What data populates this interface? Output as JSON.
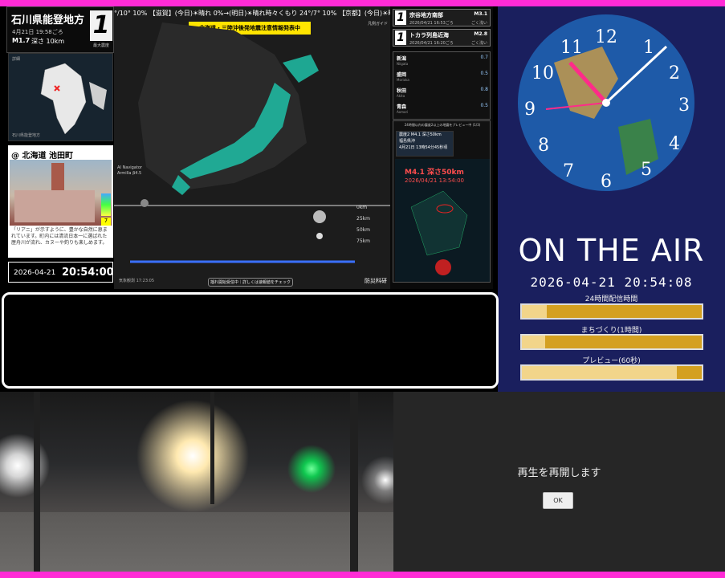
{
  "quake": {
    "region": "石川県能登地方",
    "time": "4月21日 19:58ごろ",
    "magnitude": "M1.7",
    "depth": "深さ 10km",
    "intensity": "1",
    "intensity_label": "最大震度"
  },
  "minimap": {
    "tag": "詳細",
    "caption": "石川県能登地方"
  },
  "camera_card": {
    "title": "@ 北海道 池田町",
    "scale_value": "7",
    "text": "「リアニ」が示すように、豊かな自然に恵まれています。町内には清流日本一に選ばれた歴舟川が流れ、カヌーや釣りも楽しめます。"
  },
  "local_clock": {
    "date": "2026-04-21",
    "time": "20:54:00"
  },
  "map": {
    "ticker": "°/10° 10% 【滋賀】(今日)☀晴れ 0%→(明日)☀晴れ時々くもり 24°/7° 10% 【京都】(今日)☀晴れ 0%→(",
    "alert": "北海道・三陸沖後発地震注意情報発表中",
    "ai_label_1": "AI Navigator",
    "ai_label_2": "Armilla β4.5",
    "guide_label": "凡例ガイド",
    "distances": [
      "0km",
      "25km",
      "50km",
      "75km"
    ],
    "footer": "気象観測 17:23:05",
    "button_label": "揺れ開始受信中｜詳しくは速報値をチェック",
    "brand": "防災科研"
  },
  "recent_quakes": [
    {
      "num": "1",
      "region": "宗谷地方南部",
      "time": "2026/04/21 16:53ごろ",
      "magnitude": "M3.1",
      "depth": "ごく浅い"
    },
    {
      "num": "1",
      "region": "トカラ列島近海",
      "time": "2026/04/21 16:20ごろ",
      "magnitude": "M2.8",
      "depth": "ごく浅い"
    }
  ],
  "sensors": [
    {
      "name": "新潟",
      "roman": "Niigata",
      "value": "0.7"
    },
    {
      "name": "盛岡",
      "roman": "Morioka",
      "value": "0.5"
    },
    {
      "name": "秋田",
      "roman": "Akita",
      "value": "0.8"
    },
    {
      "name": "青森",
      "roman": "Aomori",
      "value": "0.5"
    }
  ],
  "preview": {
    "header": "24時間以内の震度2以上の地震をプレビュー中 (1/3)",
    "info_line_1": "震度2 M4.1 深さ50km",
    "info_line_2": "福島県沖",
    "info_line_3": "4月21日 13時54分45秒頃",
    "overlay_1": "M4.1 深さ50km",
    "overlay_2": "2026/04/21 13:54:00"
  },
  "clock_panel": {
    "onair": "ON THE AIR",
    "datetime": "2026-04-21 20:54:08",
    "bar1_label": "24時間配信時間",
    "bar1_progress": 0.14,
    "bar2_label": "まちづくり(1時間)",
    "bar2_progress": 0.13,
    "bar3_label": "プレビュー(60秒)",
    "bar3_progress": 0.86
  },
  "resume": {
    "message": "再生を再開します",
    "ok_label": "OK"
  },
  "colors": {
    "accent": "#ff2bd6",
    "alert": "#ffe400",
    "progress": "#d4a020"
  }
}
